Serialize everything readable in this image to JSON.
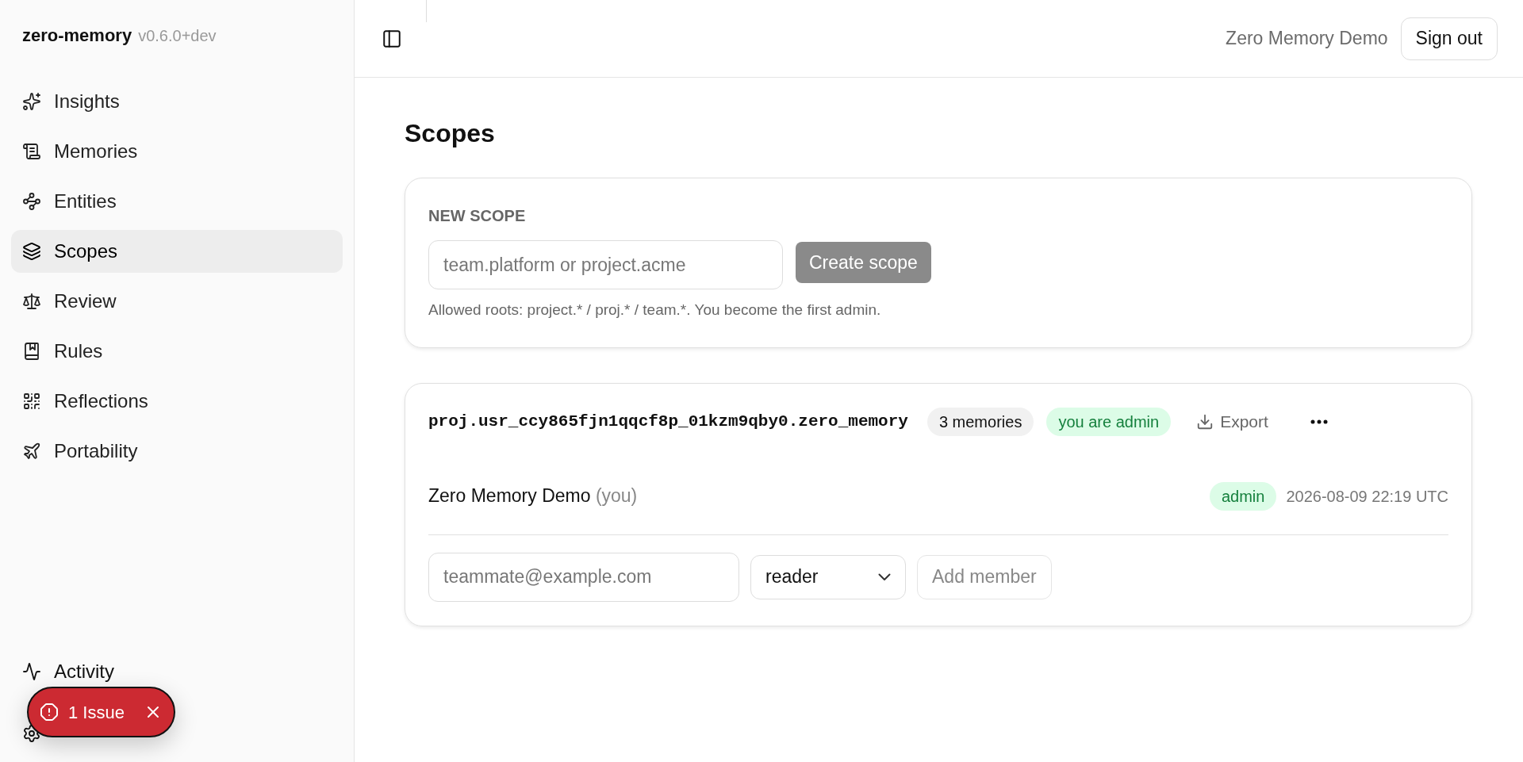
{
  "sidebar": {
    "brand": "zero-memory",
    "version": "v0.6.0+dev",
    "items": [
      {
        "kind": "insights",
        "label": "Insights",
        "selected": false
      },
      {
        "kind": "memories",
        "label": "Memories",
        "selected": false
      },
      {
        "kind": "entities",
        "label": "Entities",
        "selected": false
      },
      {
        "kind": "scopes",
        "label": "Scopes",
        "selected": true
      },
      {
        "kind": "review",
        "label": "Review",
        "selected": false
      },
      {
        "kind": "rules",
        "label": "Rules",
        "selected": false
      },
      {
        "kind": "reflections",
        "label": "Reflections",
        "selected": false
      },
      {
        "kind": "portability",
        "label": "Portability",
        "selected": false
      }
    ],
    "bottom_items": [
      {
        "kind": "activity",
        "label": "Activity"
      },
      {
        "kind": "settings"
      }
    ]
  },
  "issue_badge": {
    "label": "1 Issue"
  },
  "header": {
    "user": "Zero Memory Demo",
    "sign_out": "Sign out"
  },
  "page_title": "Scopes",
  "new_scope": {
    "heading": "NEW SCOPE",
    "placeholder": "team.platform or project.acme",
    "button": "Create scope",
    "hint": "Allowed roots: project.* / proj.* / team.*. You become the first admin."
  },
  "scopes": [
    {
      "name": "proj.usr_ccy865fjn1qqcf8p_01kzm9qby0.zero_memory",
      "count": "3 memories",
      "role_badge": "you are admin",
      "export": "Export",
      "members": [
        {
          "name": "Zero Memory Demo",
          "suffix": "(you)",
          "role": "admin",
          "date": "2026-08-09 22:19 UTC"
        }
      ],
      "invite": {
        "placeholder": "teammate@example.com",
        "role": "reader",
        "button": "Add member"
      }
    }
  ]
}
